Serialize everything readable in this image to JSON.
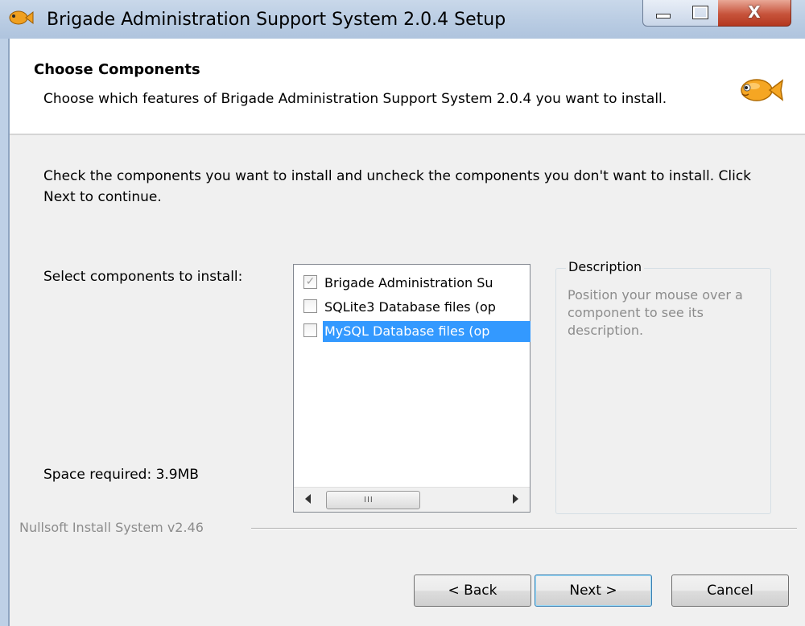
{
  "window": {
    "title": "Brigade Administration Support System 2.0.4 Setup",
    "close_glyph": "X"
  },
  "header": {
    "title": "Choose Components",
    "subtitle": "Choose which features of Brigade Administration Support System 2.0.4 you want to install.",
    "icon": "fish-icon"
  },
  "body": {
    "intro": "Check the components you want to install and uncheck the components you don't want to install. Click Next to continue.",
    "select_label": "Select components to install:",
    "space_label": "Space required: 3.9MB",
    "components": [
      {
        "label": "Brigade Administration Su",
        "checked": true,
        "disabled": true,
        "selected": false
      },
      {
        "label": "SQLite3 Database files (op",
        "checked": false,
        "disabled": false,
        "selected": false
      },
      {
        "label": "MySQL Database files (op",
        "checked": false,
        "disabled": false,
        "selected": true
      }
    ],
    "scroll_grip": "III",
    "description": {
      "title": "Description",
      "text": "Position your mouse over a component to see its description."
    }
  },
  "footer": {
    "branding": "Nullsoft Install System v2.46",
    "back_label": "< Back",
    "next_label": "Next >",
    "cancel_label": "Cancel"
  },
  "colors": {
    "selection": "#3399ff",
    "dialog_bg": "#f0f0f0",
    "titlebar": "#b8cbe2"
  }
}
